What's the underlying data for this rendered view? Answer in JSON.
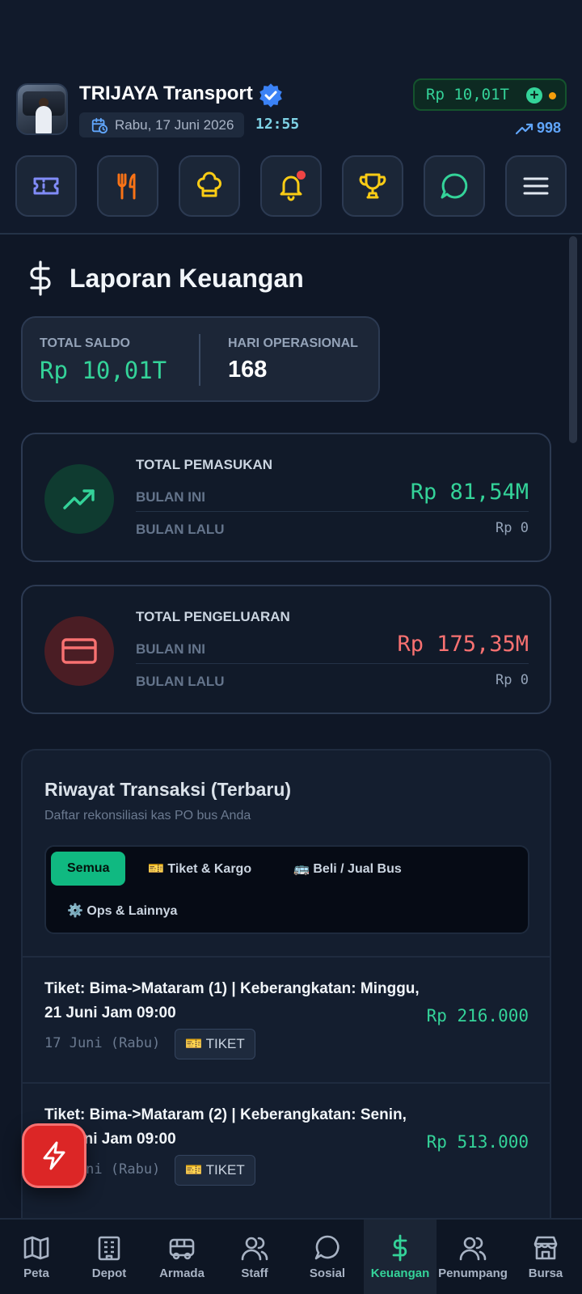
{
  "header": {
    "company_name": "TRIJAYA Transport",
    "date": "Rabu, 17 Juni 2026",
    "time": "12:55",
    "balance": "Rp 10,01T",
    "trend_value": "998"
  },
  "quick_actions": [
    {
      "name": "ticket-icon"
    },
    {
      "name": "restaurant-icon"
    },
    {
      "name": "chef-hat-icon"
    },
    {
      "name": "bell-icon",
      "has_alert": true
    },
    {
      "name": "trophy-icon"
    },
    {
      "name": "chat-icon"
    },
    {
      "name": "menu-icon"
    }
  ],
  "page": {
    "title": "Laporan Keuangan"
  },
  "summary": {
    "total_saldo_label": "TOTAL SALDO",
    "total_saldo_value": "Rp 10,01T",
    "hari_operasional_label": "HARI OPERASIONAL",
    "hari_operasional_value": "168"
  },
  "income": {
    "heading": "TOTAL PEMASUKAN",
    "this_month_label": "BULAN INI",
    "this_month_value": "Rp 81,54M",
    "last_month_label": "BULAN LALU",
    "last_month_value": "Rp 0"
  },
  "expense": {
    "heading": "TOTAL PENGELUARAN",
    "this_month_label": "BULAN INI",
    "this_month_value": "Rp 175,35M",
    "last_month_label": "BULAN LALU",
    "last_month_value": "Rp 0"
  },
  "transactions": {
    "title": "Riwayat Transaksi (Terbaru)",
    "subtitle": "Daftar rekonsiliasi kas PO bus Anda",
    "filters": [
      {
        "label": "Semua",
        "active": true
      },
      {
        "label": "🎫 Tiket & Kargo",
        "active": false
      },
      {
        "label": "🚌 Beli / Jual Bus",
        "active": false
      },
      {
        "label": "⚙️ Ops & Lainnya",
        "active": false
      }
    ],
    "items": [
      {
        "description": "Tiket: Bima->Mataram (1) | Keberangkatan: Minggu, 21 Juni Jam 09:00",
        "date": "17 Juni (Rabu)",
        "badge": "🎫 TIKET",
        "amount": "Rp 216.000"
      },
      {
        "description": "Tiket: Bima->Mataram (2) | Keberangkatan: Senin, 22 Juni Jam 09:00",
        "date": "17 Juni (Rabu)",
        "badge": "🎫 TIKET",
        "amount": "Rp 513.000"
      }
    ]
  },
  "bottom_nav": [
    {
      "label": "Peta",
      "active": false
    },
    {
      "label": "Depot",
      "active": false
    },
    {
      "label": "Armada",
      "active": false
    },
    {
      "label": "Staff",
      "active": false
    },
    {
      "label": "Sosial",
      "active": false
    },
    {
      "label": "Keuangan",
      "active": true
    },
    {
      "label": "Penumpang",
      "active": false
    },
    {
      "label": "Bursa",
      "active": false
    }
  ],
  "colors": {
    "background": "#0f1726",
    "accent_green": "#34d399",
    "accent_red": "#f87171",
    "active_chip": "#10b981",
    "fab_red": "#dc2626"
  }
}
